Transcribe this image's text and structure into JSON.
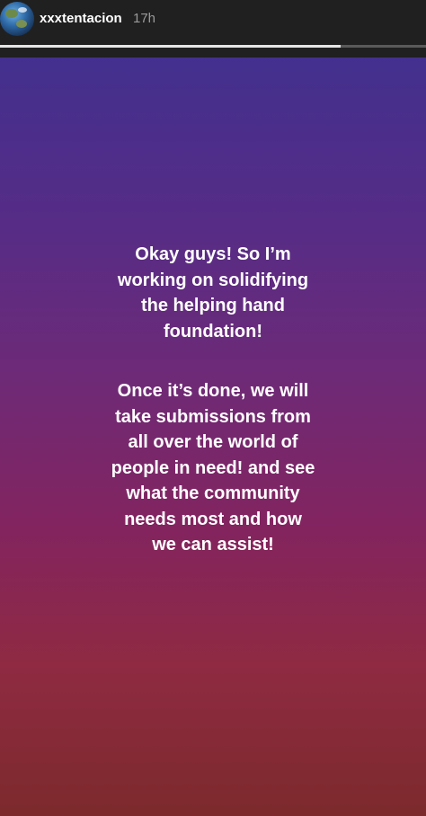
{
  "header": {
    "username": "xxxtentacion",
    "timestamp": "17h",
    "avatar_icon": "earth-globe-icon",
    "progress_fraction": 0.8
  },
  "story": {
    "paragraph1": [
      "Okay guys! So I’m",
      "working on solidifying",
      "the helping hand",
      "foundation!"
    ],
    "paragraph2": [
      "Once it’s done, we will",
      "take submissions from",
      "all over the world of",
      "people in need! and see",
      "what the community",
      "needs most and how",
      "we can assist!"
    ],
    "background_colors": [
      "#43308e",
      "#6e2a77",
      "#8f2a42",
      "#7c2a2c"
    ],
    "text_color": "#ffffff"
  }
}
